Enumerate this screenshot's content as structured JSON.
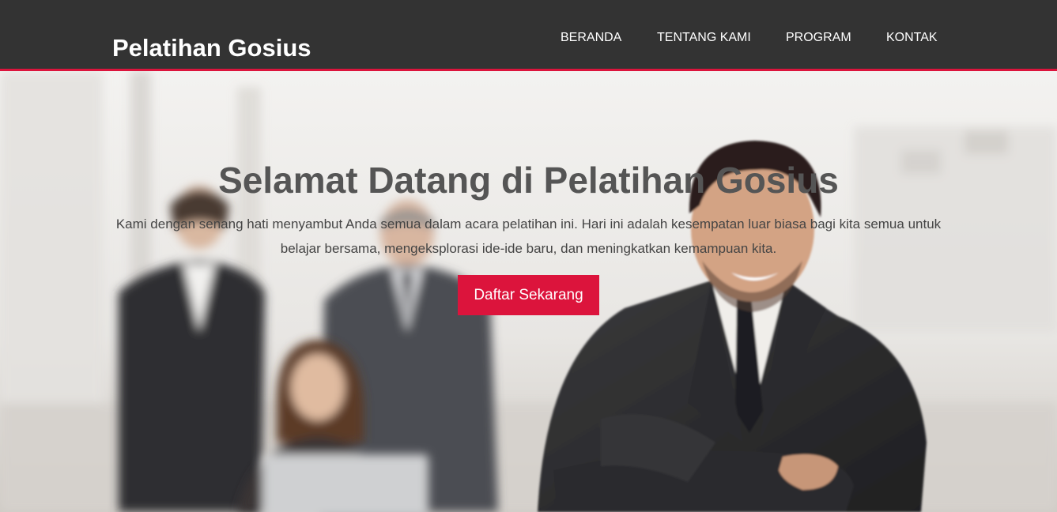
{
  "header": {
    "brand": "Pelatihan Gosius",
    "nav": [
      {
        "label": "BERANDA"
      },
      {
        "label": "TENTANG KAMI"
      },
      {
        "label": "PROGRAM"
      },
      {
        "label": "KONTAK"
      }
    ]
  },
  "hero": {
    "title": "Selamat Datang di Pelatihan Gosius",
    "text": "Kami dengan senang hati menyambut Anda semua dalam acara pelatihan ini. Hari ini adalah kesempatan luar biasa bagi kita semua untuk belajar bersama, mengeksplorasi ide-ide baru, dan meningkatkan kemampuan kita.",
    "cta_label": "Daftar Sekarang",
    "background": "office-team-photo"
  },
  "colors": {
    "navbar": "#333333",
    "accent": "#dc143c",
    "title": "#555555",
    "body_text": "#444444"
  }
}
